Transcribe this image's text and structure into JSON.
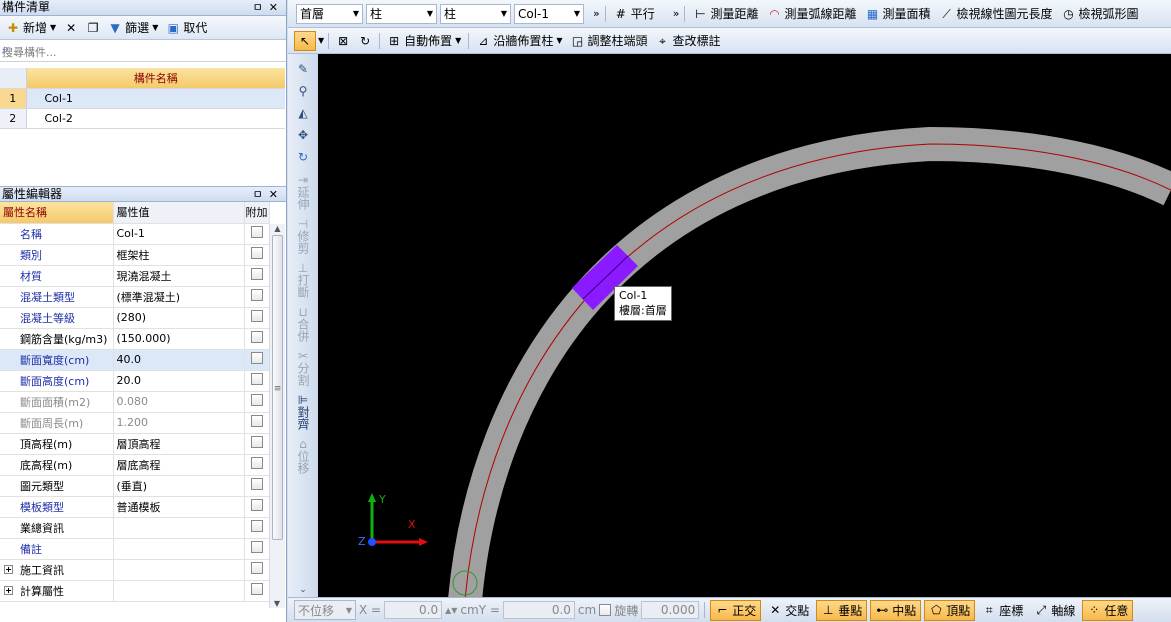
{
  "component_list": {
    "title": "構件清單",
    "toolbar": {
      "new": "新增",
      "filter": "篩選",
      "pick": "取代"
    },
    "search_placeholder": "搜尋構件...",
    "column": "構件名稱",
    "rows": [
      {
        "no": "1",
        "name": "Col-1"
      },
      {
        "no": "2",
        "name": "Col-2"
      }
    ]
  },
  "property_editor": {
    "title": "屬性編輯器",
    "headers": {
      "name": "屬性名稱",
      "value": "屬性值",
      "attach": "附加"
    },
    "rows": [
      {
        "name": "名稱",
        "value": "Col-1"
      },
      {
        "name": "類別",
        "value": "框架柱"
      },
      {
        "name": "材質",
        "value": "現澆混凝土"
      },
      {
        "name": "混凝土類型",
        "value": "(標準混凝土)"
      },
      {
        "name": "混凝土等級",
        "value": "(280)"
      },
      {
        "name": "鋼筋含量(kg/m3)",
        "value": "(150.000)"
      },
      {
        "name": "斷面寬度(cm)",
        "value": "40.0"
      },
      {
        "name": "斷面高度(cm)",
        "value": "20.0"
      },
      {
        "name": "斷面面積(m2)",
        "value": "0.080"
      },
      {
        "name": "斷面周長(m)",
        "value": "1.200"
      },
      {
        "name": "頂高程(m)",
        "value": "層頂高程"
      },
      {
        "name": "底高程(m)",
        "value": "層底高程"
      },
      {
        "name": "圖元類型",
        "value": "(垂直)"
      },
      {
        "name": "模板類型",
        "value": "普通模板"
      },
      {
        "name": "業總資訊",
        "value": ""
      },
      {
        "name": "備註",
        "value": ""
      },
      {
        "name": "施工資訊",
        "value": ""
      },
      {
        "name": "計算屬性",
        "value": ""
      }
    ]
  },
  "top_toolbar": {
    "floor": "首層",
    "type1": "柱",
    "type2": "柱",
    "component": "Col-1",
    "parallel": "平行",
    "measure_distance": "測量距離",
    "measure_arc": "測量弧線距離",
    "measure_area": "測量面積",
    "check_linear": "檢視線性圖元長度",
    "check_arc": "檢視弧形圖"
  },
  "draw_toolbar": {
    "auto_place": "自動佈置",
    "place_along_wall": "沿牆佈置柱",
    "adjust_end": "調整柱端頭",
    "change_label": "查改標註"
  },
  "vertical_tools": {
    "extend": "延伸",
    "trim": "修剪",
    "break": "打斷",
    "merge": "合併",
    "split": "分割",
    "align": "對齊",
    "offset": "位移"
  },
  "canvas": {
    "tooltip_line1": "Col-1",
    "tooltip_line2": "樓層:首層",
    "axis_x": "X",
    "axis_y": "Y",
    "axis_z": "Z",
    "colors": {
      "band": "#a0a0a0",
      "centerline": "#b00000",
      "column": "#8a1aff"
    }
  },
  "status_bar": {
    "move_mode": "不位移",
    "x_label": "X =",
    "x_value": "0.0",
    "y_label": "cmY =",
    "y_value": "0.0",
    "unit": "cm",
    "rotate": "旋轉",
    "rotate_value": "0.000",
    "ortho": "正交",
    "intersect": "交點",
    "perpendicular": "垂點",
    "midpoint": "中點",
    "vertex": "頂點",
    "coord": "座標",
    "axis": "軸線",
    "any": "任意"
  }
}
